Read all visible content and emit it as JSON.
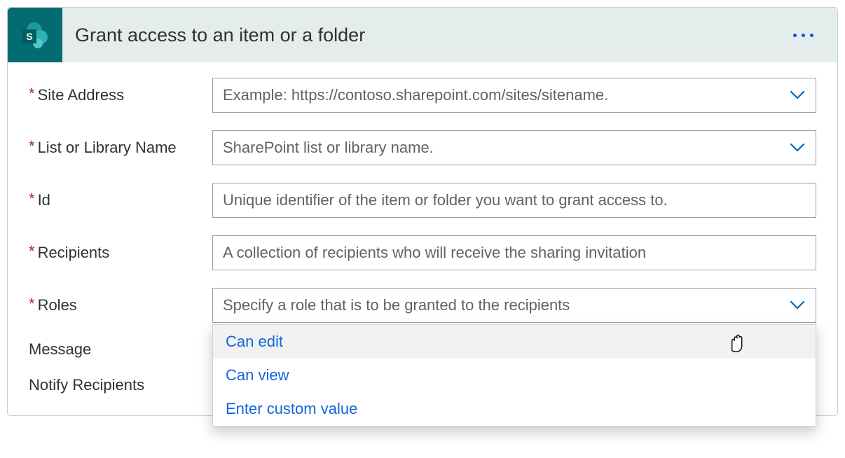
{
  "header": {
    "title": "Grant access to an item or a folder"
  },
  "fields": {
    "site_address": {
      "label": "Site Address",
      "placeholder": "Example: https://contoso.sharepoint.com/sites/sitename.",
      "required": true
    },
    "list_or_library": {
      "label": "List or Library Name",
      "placeholder": "SharePoint list or library name.",
      "required": true
    },
    "id": {
      "label": "Id",
      "placeholder": "Unique identifier of the item or folder you want to grant access to.",
      "required": true
    },
    "recipients": {
      "label": "Recipients",
      "placeholder": "A collection of recipients who will receive the sharing invitation",
      "required": true
    },
    "roles": {
      "label": "Roles",
      "placeholder": "Specify a role that is to be granted to the recipients",
      "required": true,
      "options": [
        "Can edit",
        "Can view",
        "Enter custom value"
      ]
    },
    "message": {
      "label": "Message",
      "required": false
    },
    "notify": {
      "label": "Notify Recipients",
      "required": false
    }
  }
}
